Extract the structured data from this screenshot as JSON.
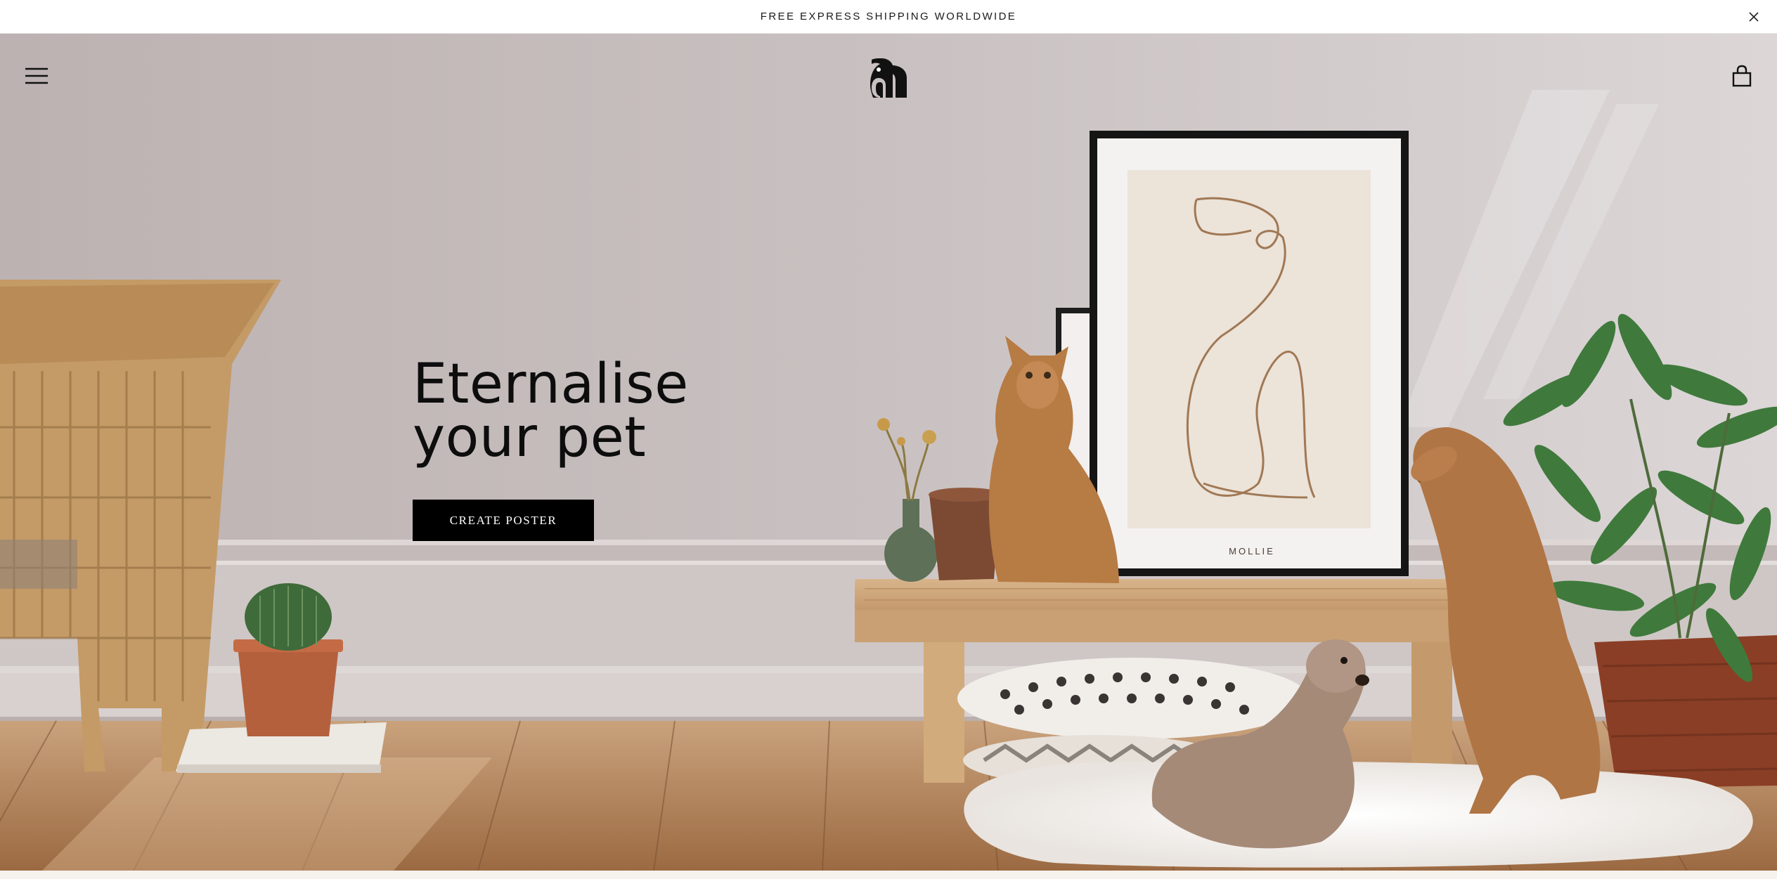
{
  "announcement": {
    "text": "FREE EXPRESS SHIPPING WORLDWIDE",
    "close_icon": "close-icon"
  },
  "header": {
    "menu_icon": "hamburger-menu-icon",
    "logo_icon": "brand-logo",
    "cart_icon": "shopping-bag-icon"
  },
  "hero": {
    "title": "Eternalise your pet",
    "cta_label": "CREATE POSTER",
    "poster_name": "MOLLIE"
  },
  "colors": {
    "cta_background": "#000000",
    "cta_text": "#ffffff",
    "title_text": "#0d0d0d",
    "wall": "#c8bfbf",
    "floor": "#b07a4f"
  }
}
